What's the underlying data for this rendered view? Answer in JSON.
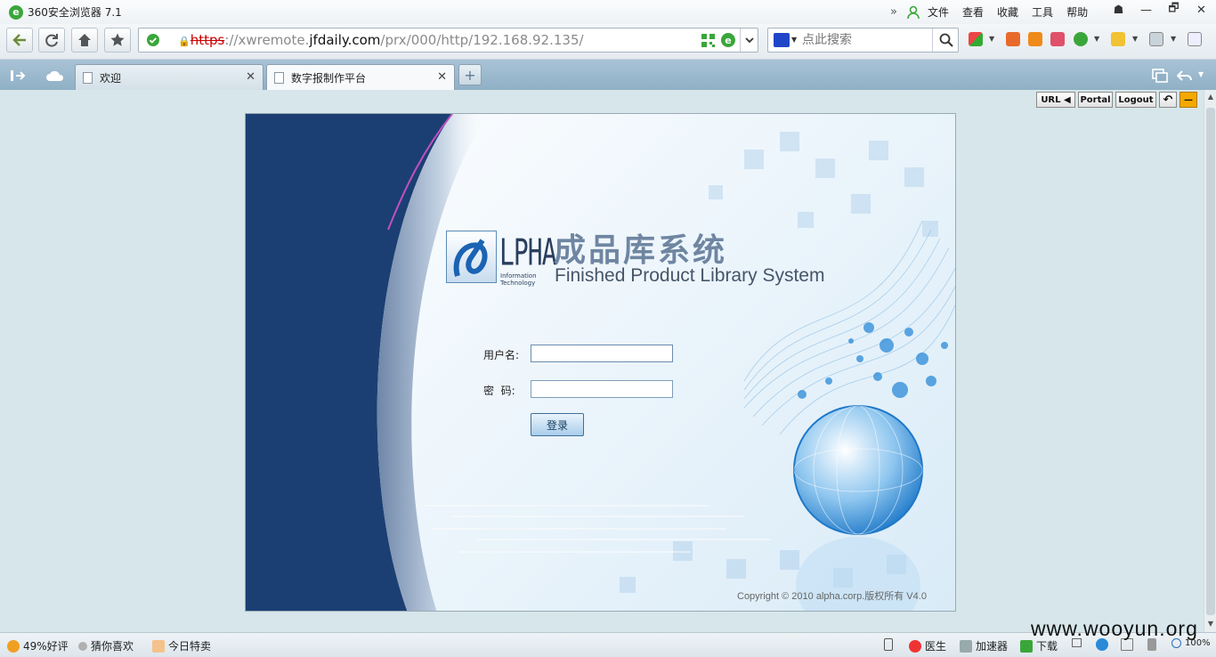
{
  "window": {
    "title": "360安全浏览器  7.1",
    "menu": [
      "文件",
      "查看",
      "收藏",
      "工具",
      "帮助"
    ],
    "menu_chevron": "»",
    "controls": {
      "skin": "☗",
      "minimize": "—",
      "restore": "🗗",
      "close": "✕"
    }
  },
  "nav": {
    "back_icon": "back-arrow-icon",
    "refresh_icon": "refresh-icon",
    "home_icon": "home-icon",
    "favorite_icon": "star-icon",
    "address": {
      "scheme": "https",
      "sep": "://",
      "sub": "xwremote.",
      "domain": "jfdaily.com",
      "path": "/prx/000/http/192.168.92.135/"
    },
    "search_placeholder": "点此搜索"
  },
  "tabs": [
    {
      "label": "欢迎",
      "active": false
    },
    {
      "label": "数字报制作平台",
      "active": true
    }
  ],
  "portal_toolbar": {
    "url_label": "URL ◀",
    "portal_label": "Portal",
    "logout_label": "Logout",
    "undo_symbol": "↶",
    "minimize_symbol": "—"
  },
  "login": {
    "logo_letters": "LPHA",
    "logo_info_line1": "Information",
    "logo_info_line2": "Technology",
    "system_name_cn": "成品库系统",
    "system_name_en": "Finished Product Library System",
    "username_label": "用户名:",
    "username_value": "",
    "password_label": "密  码:",
    "password_value": "",
    "submit_label": "登录",
    "copyright": "Copyright © 2010 alpha.corp.版权所有  V4.0"
  },
  "statusbar": {
    "rating": "49%好评",
    "guess": "猜你喜欢",
    "deals": "今日特卖",
    "doctor": "医生",
    "accelerator": "加速器",
    "download": "下载",
    "zoom": "100%"
  },
  "watermark": "www.wooyun.org",
  "colors": {
    "brand_green": "#3aa63a",
    "frame_navy": "#1b3f73",
    "page_bg": "#d6e6ea",
    "accent_orange": "#f4a800"
  }
}
